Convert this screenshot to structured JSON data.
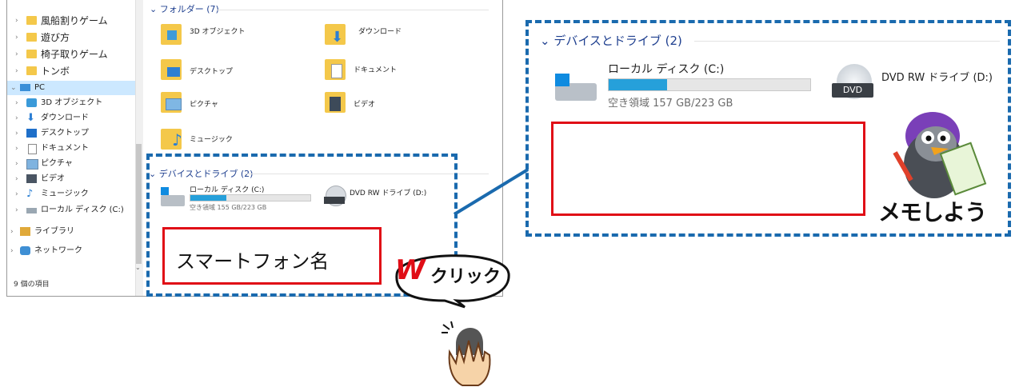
{
  "explorer": {
    "nav_items": [
      {
        "label": "風船割りゲーム"
      },
      {
        "label": "遊び方"
      },
      {
        "label": "椅子取りゲーム"
      },
      {
        "label": "トンボ"
      },
      {
        "label": "PC"
      },
      {
        "label": "3D オブジェクト"
      },
      {
        "label": "ダウンロード"
      },
      {
        "label": "デスクトップ"
      },
      {
        "label": "ドキュメント"
      },
      {
        "label": "ピクチャ"
      },
      {
        "label": "ビデオ"
      },
      {
        "label": "ミュージック"
      },
      {
        "label": "ローカル ディスク (C:)"
      },
      {
        "label": "ライブラリ"
      },
      {
        "label": "ネットワーク"
      }
    ],
    "status": "9 個の項目",
    "folders_header": "フォルダー (7)",
    "folders": [
      {
        "label": "3D オブジェクト"
      },
      {
        "label": "ダウンロード"
      },
      {
        "label": "デスクトップ"
      },
      {
        "label": "ドキュメント"
      },
      {
        "label": "ピクチャ"
      },
      {
        "label": "ビデオ"
      },
      {
        "label": "ミュージック"
      }
    ],
    "devices_header": "デバイスとドライブ (2)",
    "local_disk": {
      "name": "ローカル ディスク (C:)",
      "free": "空き領域 155 GB/223 GB",
      "usage_fraction": 0.3
    },
    "dvd": {
      "name": "DVD RW ドライブ (D:)"
    },
    "smartphone_label": "スマートフォン名"
  },
  "zoom": {
    "devices_header": "デバイスとドライブ (2)",
    "local_disk": {
      "name": "ローカル ディスク (C:)",
      "free": "空き領域 157 GB/223 GB",
      "usage_fraction": 0.29
    },
    "dvd": {
      "name": "DVD RW ドライブ (D:)",
      "disc_text": "DVD"
    }
  },
  "callout": {
    "w": "W",
    "click": "クリック"
  },
  "memo": {
    "text": "メモしよう"
  }
}
